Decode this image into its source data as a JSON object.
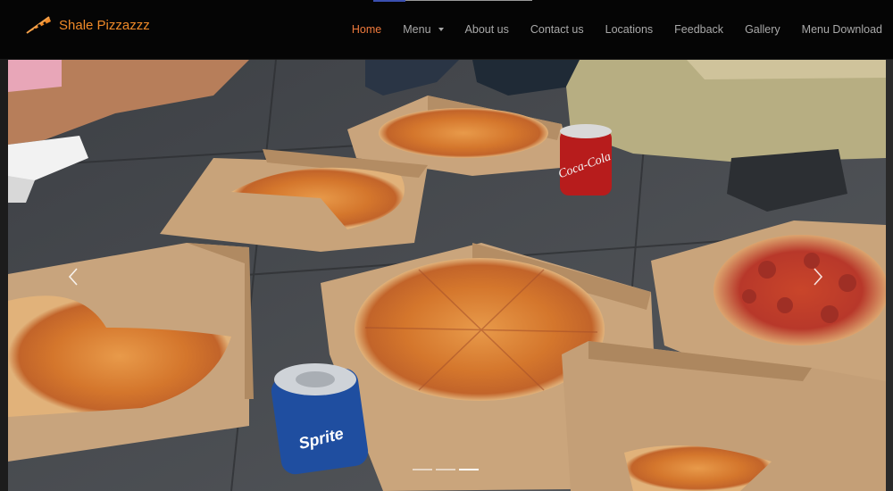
{
  "brand": {
    "name": "Shale Pizzazzz",
    "icon": "pizza-slice-icon"
  },
  "nav": {
    "items": [
      {
        "label": "Home",
        "active": true
      },
      {
        "label": "Menu",
        "dropdown": true
      },
      {
        "label": "About us"
      },
      {
        "label": "Contact us"
      },
      {
        "label": "Locations"
      },
      {
        "label": "Feedback"
      },
      {
        "label": "Gallery"
      },
      {
        "label": "Menu Download"
      }
    ]
  },
  "carousel": {
    "image": "pizza-boxes-on-floor-photo",
    "prev_icon": "chevron-left-icon",
    "next_icon": "chevron-right-icon",
    "slides": 3,
    "active_slide": 3
  },
  "colors": {
    "brand": "#f08a28",
    "active_nav": "#ef7a3c",
    "nav_text": "#a9a9a9",
    "navbar_bg": "#050505"
  }
}
